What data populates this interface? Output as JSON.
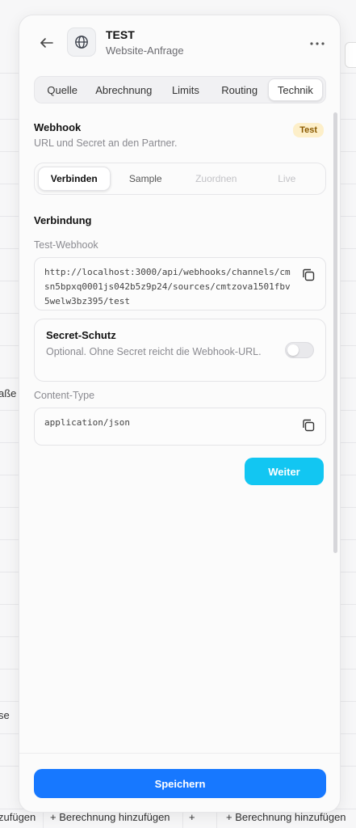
{
  "header": {
    "title": "TEST",
    "subtitle": "Website-Anfrage",
    "back_icon": "arrow-left-icon",
    "source_icon": "globe-icon",
    "more_icon": "more-horizontal-icon"
  },
  "tabs": [
    {
      "label": "Quelle",
      "active": false
    },
    {
      "label": "Abrechnung",
      "active": false
    },
    {
      "label": "Limits",
      "active": false
    },
    {
      "label": "Routing",
      "active": false
    },
    {
      "label": "Technik",
      "active": true
    }
  ],
  "section": {
    "title": "Webhook",
    "subtitle": "URL und Secret an den Partner.",
    "badge": "Test"
  },
  "steps": [
    {
      "label": "Verbinden",
      "state": "active"
    },
    {
      "label": "Sample",
      "state": "normal"
    },
    {
      "label": "Zuordnen",
      "state": "disabled"
    },
    {
      "label": "Live",
      "state": "disabled"
    }
  ],
  "connection": {
    "title": "Verbindung",
    "webhook_label": "Test-Webhook",
    "webhook_url": "http://localhost:3000/api/webhooks/channels/cmsn5bpxq0001js042b5z9p24/sources/cmtzova1501fbv5welw3bz395/test",
    "secret_title": "Secret-Schutz",
    "secret_desc": "Optional. Ohne Secret reicht die Webhook-URL.",
    "secret_enabled": false,
    "content_type_label": "Content-Type",
    "content_type_value": "application/json"
  },
  "buttons": {
    "next": "Weiter",
    "save": "Speichern"
  },
  "background": {
    "left_text_1": "aße",
    "left_text_2": "se",
    "bottom_left": "zufügen",
    "bottom_middle": "+ Berechnung hinzufügen",
    "bottom_plus": "+",
    "bottom_right": "+ Berechnung hinzufügen"
  },
  "colors": {
    "accent": "#12c6f2",
    "primary": "#1778ff",
    "badge_bg": "#fdefc9",
    "badge_text": "#8a5a00"
  }
}
